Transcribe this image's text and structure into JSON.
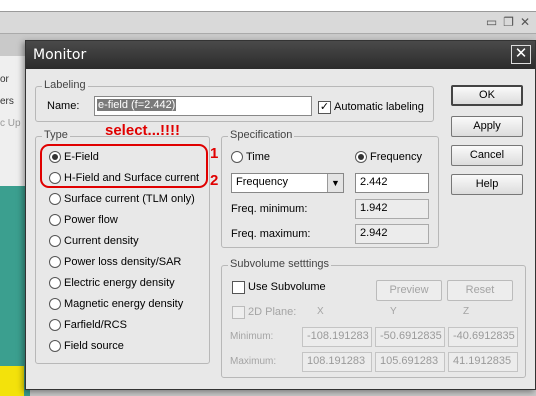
{
  "background": {
    "side_items": [
      "or",
      "ers",
      "c Up"
    ]
  },
  "dialog": {
    "title": "Monitor",
    "labeling": {
      "legend": "Labeling",
      "name_label": "Name:",
      "name_value": "e-field (f=2.442)",
      "auto_label": "Automatic labeling"
    },
    "buttons": {
      "ok": "OK",
      "apply": "Apply",
      "cancel": "Cancel",
      "help": "Help"
    },
    "type": {
      "legend": "Type",
      "options": [
        "E-Field",
        "H-Field and Surface current",
        "Surface current (TLM only)",
        "Power flow",
        "Current density",
        "Power loss density/SAR",
        "Electric energy density",
        "Magnetic energy density",
        "Farfield/RCS",
        "Field source"
      ],
      "selected_index": 0
    },
    "specification": {
      "legend": "Specification",
      "time_label": "Time",
      "frequency_label": "Frequency",
      "select_value": "Frequency",
      "value": "2.442",
      "freq_min_label": "Freq. minimum:",
      "freq_min_value": "1.942",
      "freq_max_label": "Freq. maximum:",
      "freq_max_value": "2.942"
    },
    "subvolume": {
      "legend": "Subvolume setttings",
      "use_label": "Use Subvolume",
      "preview": "Preview",
      "reset": "Reset",
      "plane_label": "2D Plane:",
      "col_x": "X",
      "col_y": "Y",
      "col_z": "Z",
      "min_label": "Minimum:",
      "max_label": "Maximum:",
      "min_x": "-108.191283",
      "min_y": "-50.6912835",
      "min_z": "-40.6912835",
      "max_x": "108.191283",
      "max_y": "105.691283",
      "max_z": "41.1912835"
    }
  },
  "annotation": {
    "select_text": "select...!!!!",
    "num1": "1",
    "num2": "2",
    "color": "#e00000"
  }
}
